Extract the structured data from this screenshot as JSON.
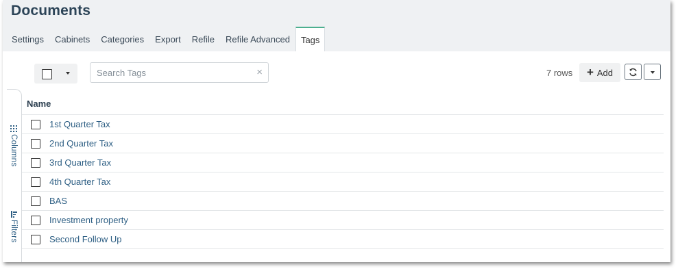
{
  "header": {
    "title": "Documents",
    "tabs": [
      {
        "label": "Settings"
      },
      {
        "label": "Cabinets"
      },
      {
        "label": "Categories"
      },
      {
        "label": "Export"
      },
      {
        "label": "Refile"
      },
      {
        "label": "Refile Advanced"
      },
      {
        "label": "Tags",
        "active": true
      }
    ]
  },
  "toolbar": {
    "search_placeholder": "Search Tags",
    "search_value": "",
    "clear_icon": "×",
    "row_count": "7 rows",
    "add_label": "Add",
    "add_icon": "+"
  },
  "side_panel": {
    "columns_label": "Columns",
    "filters_label": "Filters"
  },
  "table": {
    "columns": [
      "Name"
    ],
    "rows": [
      {
        "name": "1st Quarter Tax"
      },
      {
        "name": "2nd Quarter Tax"
      },
      {
        "name": "3rd Quarter Tax"
      },
      {
        "name": "4th Quarter Tax"
      },
      {
        "name": "BAS"
      },
      {
        "name": "Investment property"
      },
      {
        "name": "Second Follow Up"
      }
    ]
  },
  "colors": {
    "header_bg": "#eff1f3",
    "title": "#2c4457",
    "active_tab_accent": "#4caf8f",
    "link": "#2e5f84"
  }
}
